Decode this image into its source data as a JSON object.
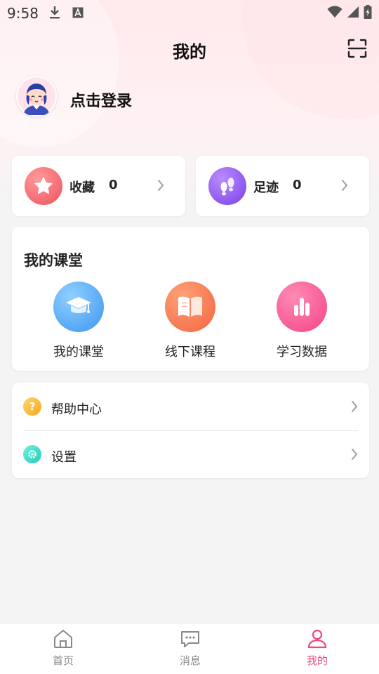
{
  "status_bar": {
    "time": "9:58"
  },
  "header": {
    "title": "我的"
  },
  "profile": {
    "login_text": "点击登录"
  },
  "quick_links": [
    {
      "label": "收藏",
      "count": "0"
    },
    {
      "label": "足迹",
      "count": "0"
    }
  ],
  "classroom": {
    "title": "我的课堂",
    "items": [
      {
        "label": "我的课堂",
        "icon": "graduation-cap-icon"
      },
      {
        "label": "线下课程",
        "icon": "book-icon"
      },
      {
        "label": "学习数据",
        "icon": "bar-chart-icon"
      }
    ]
  },
  "menu": [
    {
      "label": "帮助中心",
      "icon": "question-icon"
    },
    {
      "label": "设置",
      "icon": "settings-icon"
    }
  ],
  "tabs": [
    {
      "label": "首页",
      "icon": "home-icon"
    },
    {
      "label": "消息",
      "icon": "message-icon"
    },
    {
      "label": "我的",
      "icon": "user-icon",
      "active": true
    }
  ],
  "colors": {
    "accent": "#f0467c",
    "background": "#f4f4f5"
  }
}
